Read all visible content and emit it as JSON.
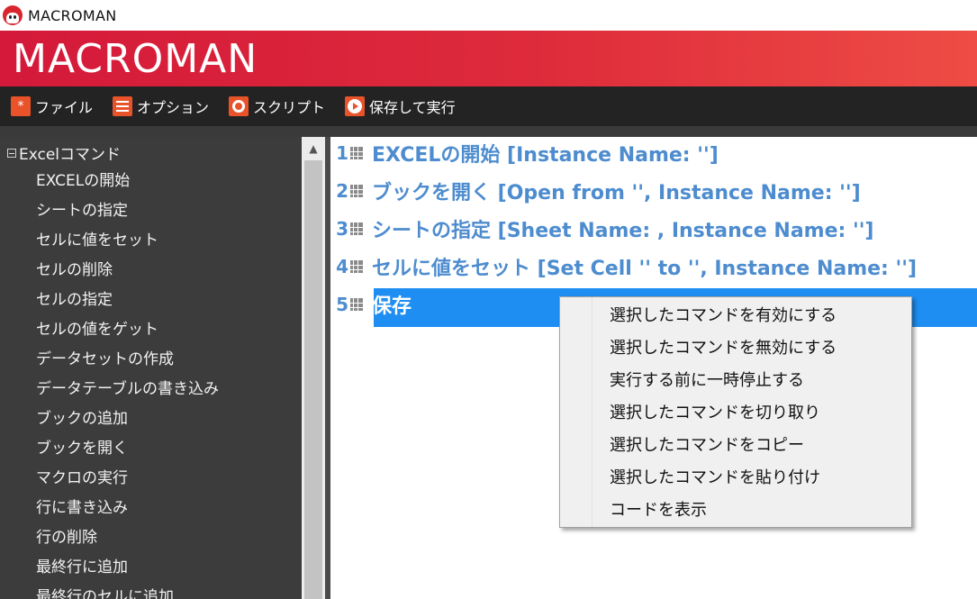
{
  "window": {
    "title": "MACROMAN"
  },
  "banner": {
    "brand": "MACROMAN"
  },
  "menubar": {
    "items": [
      {
        "label": "ファイル",
        "icon": "asterisk-icon"
      },
      {
        "label": "オプション",
        "icon": "list-icon"
      },
      {
        "label": "スクリプト",
        "icon": "disc-icon"
      },
      {
        "label": "保存して実行",
        "icon": "play-icon"
      }
    ]
  },
  "sidebar": {
    "root_label": "Excelコマンド",
    "items": [
      "EXCELの開始",
      "シートの指定",
      "セルに値をセット",
      "セルの削除",
      "セルの指定",
      "セルの値をゲット",
      "データセットの作成",
      "データテーブルの書き込み",
      "ブックの追加",
      "ブックを開く",
      "マクロの実行",
      "行に書き込み",
      "行の削除",
      "最終行に追加",
      "最終行のセルに追加"
    ]
  },
  "commands": [
    {
      "num": "1",
      "text": "EXCELの開始 [Instance Name: '']"
    },
    {
      "num": "2",
      "text": "ブックを開く [Open from '', Instance Name: '']"
    },
    {
      "num": "3",
      "text": "シートの指定 [Sheet Name: , Instance Name: '']"
    },
    {
      "num": "4",
      "text": "セルに値をセット [Set Cell '' to '', Instance Name: '']"
    },
    {
      "num": "5",
      "text": "保存"
    }
  ],
  "context_menu": {
    "items": [
      "選択したコマンドを有効にする",
      "選択したコマンドを無効にする",
      "実行する前に一時停止する",
      "選択したコマンドを切り取り",
      "選択したコマンドをコピー",
      "選択したコマンドを貼り付け",
      "コードを表示"
    ]
  },
  "colors": {
    "accent": "#e8532a",
    "banner_red": "#d4193a",
    "command_blue": "#4d8ccf",
    "selection_blue": "#1e8ef2"
  }
}
